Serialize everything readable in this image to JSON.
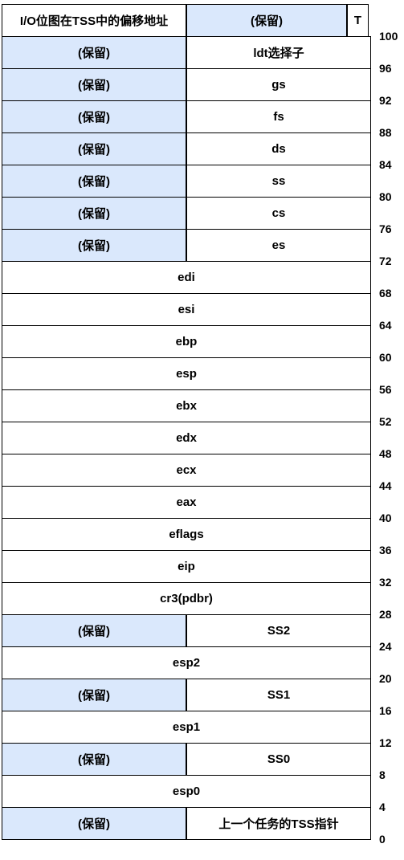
{
  "colors": {
    "reserved": "#dae8fc",
    "normal": "#ffffff",
    "border": "#000000"
  },
  "rows": [
    {
      "cells": [
        {
          "label": "I/O位图在TSS中的偏移地址",
          "kind": "normal"
        },
        {
          "label": "(保留)",
          "kind": "reserved"
        },
        {
          "label": "T",
          "kind": "normal"
        }
      ]
    },
    {
      "cells": [
        {
          "label": "(保留)",
          "kind": "reserved"
        },
        {
          "label": "ldt选择子",
          "kind": "normal"
        }
      ]
    },
    {
      "cells": [
        {
          "label": "(保留)",
          "kind": "reserved"
        },
        {
          "label": "gs",
          "kind": "normal"
        }
      ]
    },
    {
      "cells": [
        {
          "label": "(保留)",
          "kind": "reserved"
        },
        {
          "label": "fs",
          "kind": "normal"
        }
      ]
    },
    {
      "cells": [
        {
          "label": "(保留)",
          "kind": "reserved"
        },
        {
          "label": "ds",
          "kind": "normal"
        }
      ]
    },
    {
      "cells": [
        {
          "label": "(保留)",
          "kind": "reserved"
        },
        {
          "label": "ss",
          "kind": "normal"
        }
      ]
    },
    {
      "cells": [
        {
          "label": "(保留)",
          "kind": "reserved"
        },
        {
          "label": "cs",
          "kind": "normal"
        }
      ]
    },
    {
      "cells": [
        {
          "label": "(保留)",
          "kind": "reserved"
        },
        {
          "label": "es",
          "kind": "normal"
        }
      ]
    },
    {
      "cells": [
        {
          "label": "edi",
          "kind": "normal"
        }
      ]
    },
    {
      "cells": [
        {
          "label": "esi",
          "kind": "normal"
        }
      ]
    },
    {
      "cells": [
        {
          "label": "ebp",
          "kind": "normal"
        }
      ]
    },
    {
      "cells": [
        {
          "label": "esp",
          "kind": "normal"
        }
      ]
    },
    {
      "cells": [
        {
          "label": "ebx",
          "kind": "normal"
        }
      ]
    },
    {
      "cells": [
        {
          "label": "edx",
          "kind": "normal"
        }
      ]
    },
    {
      "cells": [
        {
          "label": "ecx",
          "kind": "normal"
        }
      ]
    },
    {
      "cells": [
        {
          "label": "eax",
          "kind": "normal"
        }
      ]
    },
    {
      "cells": [
        {
          "label": "eflags",
          "kind": "normal"
        }
      ]
    },
    {
      "cells": [
        {
          "label": "eip",
          "kind": "normal"
        }
      ]
    },
    {
      "cells": [
        {
          "label": "cr3(pdbr)",
          "kind": "normal"
        }
      ]
    },
    {
      "cells": [
        {
          "label": "(保留)",
          "kind": "reserved"
        },
        {
          "label": "SS2",
          "kind": "normal"
        }
      ]
    },
    {
      "cells": [
        {
          "label": "esp2",
          "kind": "normal"
        }
      ]
    },
    {
      "cells": [
        {
          "label": "(保留)",
          "kind": "reserved"
        },
        {
          "label": "SS1",
          "kind": "normal"
        }
      ]
    },
    {
      "cells": [
        {
          "label": "esp1",
          "kind": "normal"
        }
      ]
    },
    {
      "cells": [
        {
          "label": "(保留)",
          "kind": "reserved"
        },
        {
          "label": "SS0",
          "kind": "normal"
        }
      ]
    },
    {
      "cells": [
        {
          "label": "esp0",
          "kind": "normal"
        }
      ]
    },
    {
      "cells": [
        {
          "label": "(保留)",
          "kind": "reserved"
        },
        {
          "label": "上一个任务的TSS指针",
          "kind": "normal"
        }
      ]
    }
  ],
  "offsets": [
    "100",
    "96",
    "92",
    "88",
    "84",
    "80",
    "76",
    "72",
    "68",
    "64",
    "60",
    "56",
    "52",
    "48",
    "44",
    "40",
    "36",
    "32",
    "28",
    "24",
    "20",
    "16",
    "12",
    "8",
    "4",
    "0"
  ]
}
